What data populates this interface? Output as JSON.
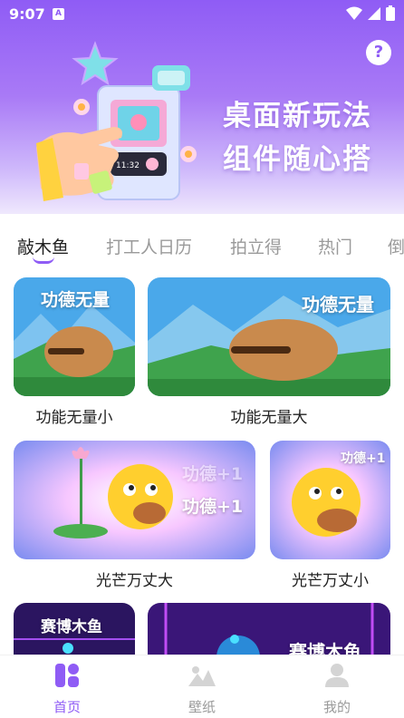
{
  "status_bar": {
    "time": "9:07",
    "a_icon": "A"
  },
  "header": {
    "line1": "桌面新玩法",
    "line2": "组件随心搭",
    "help_icon": "?",
    "widget_time": "11:32"
  },
  "tabs": [
    {
      "label": "敲木鱼",
      "active": true
    },
    {
      "label": "打工人日历",
      "active": false
    },
    {
      "label": "拍立得",
      "active": false
    },
    {
      "label": "热门",
      "active": false
    },
    {
      "label": "倒",
      "active": false
    }
  ],
  "cards": [
    {
      "title": "功能无量小",
      "overlay": "功德无量"
    },
    {
      "title": "功能无量大",
      "overlay": "功德无量"
    },
    {
      "title": "光芒万丈大",
      "overlay": "功德+1",
      "overlay_faded": "功德+1"
    },
    {
      "title": "光芒万丈小",
      "overlay": "功德+1"
    },
    {
      "title": "",
      "overlay": "赛博木鱼"
    },
    {
      "title": "",
      "overlay": "赛博木鱼"
    }
  ],
  "bottom_nav": [
    {
      "label": "首页",
      "icon": "home-grid-icon",
      "active": true
    },
    {
      "label": "壁纸",
      "icon": "mountain-image-icon",
      "active": false
    },
    {
      "label": "我的",
      "icon": "user-icon",
      "active": false
    }
  ],
  "colors": {
    "accent": "#8f5cf5",
    "inactive": "#9a9a9a"
  }
}
